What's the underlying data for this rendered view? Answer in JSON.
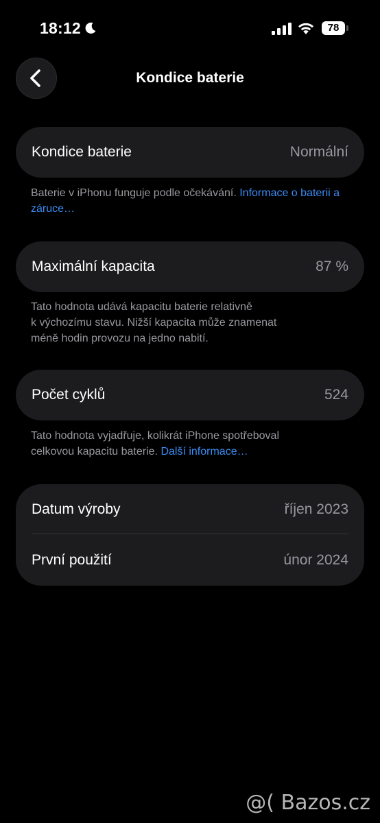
{
  "status_bar": {
    "time": "18:12",
    "battery_level": "78",
    "icons": [
      "moon-icon",
      "signal-icon",
      "wifi-icon",
      "battery-icon"
    ]
  },
  "nav": {
    "title": "Kondice baterie",
    "back_icon": "chevron-left-icon"
  },
  "battery_health": {
    "label": "Kondice baterie",
    "value": "Normální",
    "footnote_text": "Baterie v iPhonu funguje podle očekávání. ",
    "footnote_link": "Informace o baterii a záruce…"
  },
  "max_capacity": {
    "label": "Maximální kapacita",
    "value": "87 %",
    "footnote_line1": "Tato hodnota udává kapacitu baterie relativně",
    "footnote_line2": "k výchozímu stavu. Nižší kapacita může znamenat",
    "footnote_line3": "méně hodin provozu na jedno nabití."
  },
  "cycle_count": {
    "label": "Počet cyklů",
    "value": "524",
    "footnote_line1": "Tato hodnota vyjadřuje, kolikrát iPhone spotřeboval",
    "footnote_line2_text": "celkovou kapacitu baterie. ",
    "footnote_link": "Další informace…"
  },
  "dates": {
    "manufacture_label": "Datum výroby",
    "manufacture_value": "říjen 2023",
    "first_use_label": "První použití",
    "first_use_value": "únor 2024"
  },
  "watermark": "@( Bazos.cz",
  "colors": {
    "background": "#000000",
    "card": "#1c1c1e",
    "secondary_text": "#98989f",
    "link": "#3b8cf5"
  }
}
